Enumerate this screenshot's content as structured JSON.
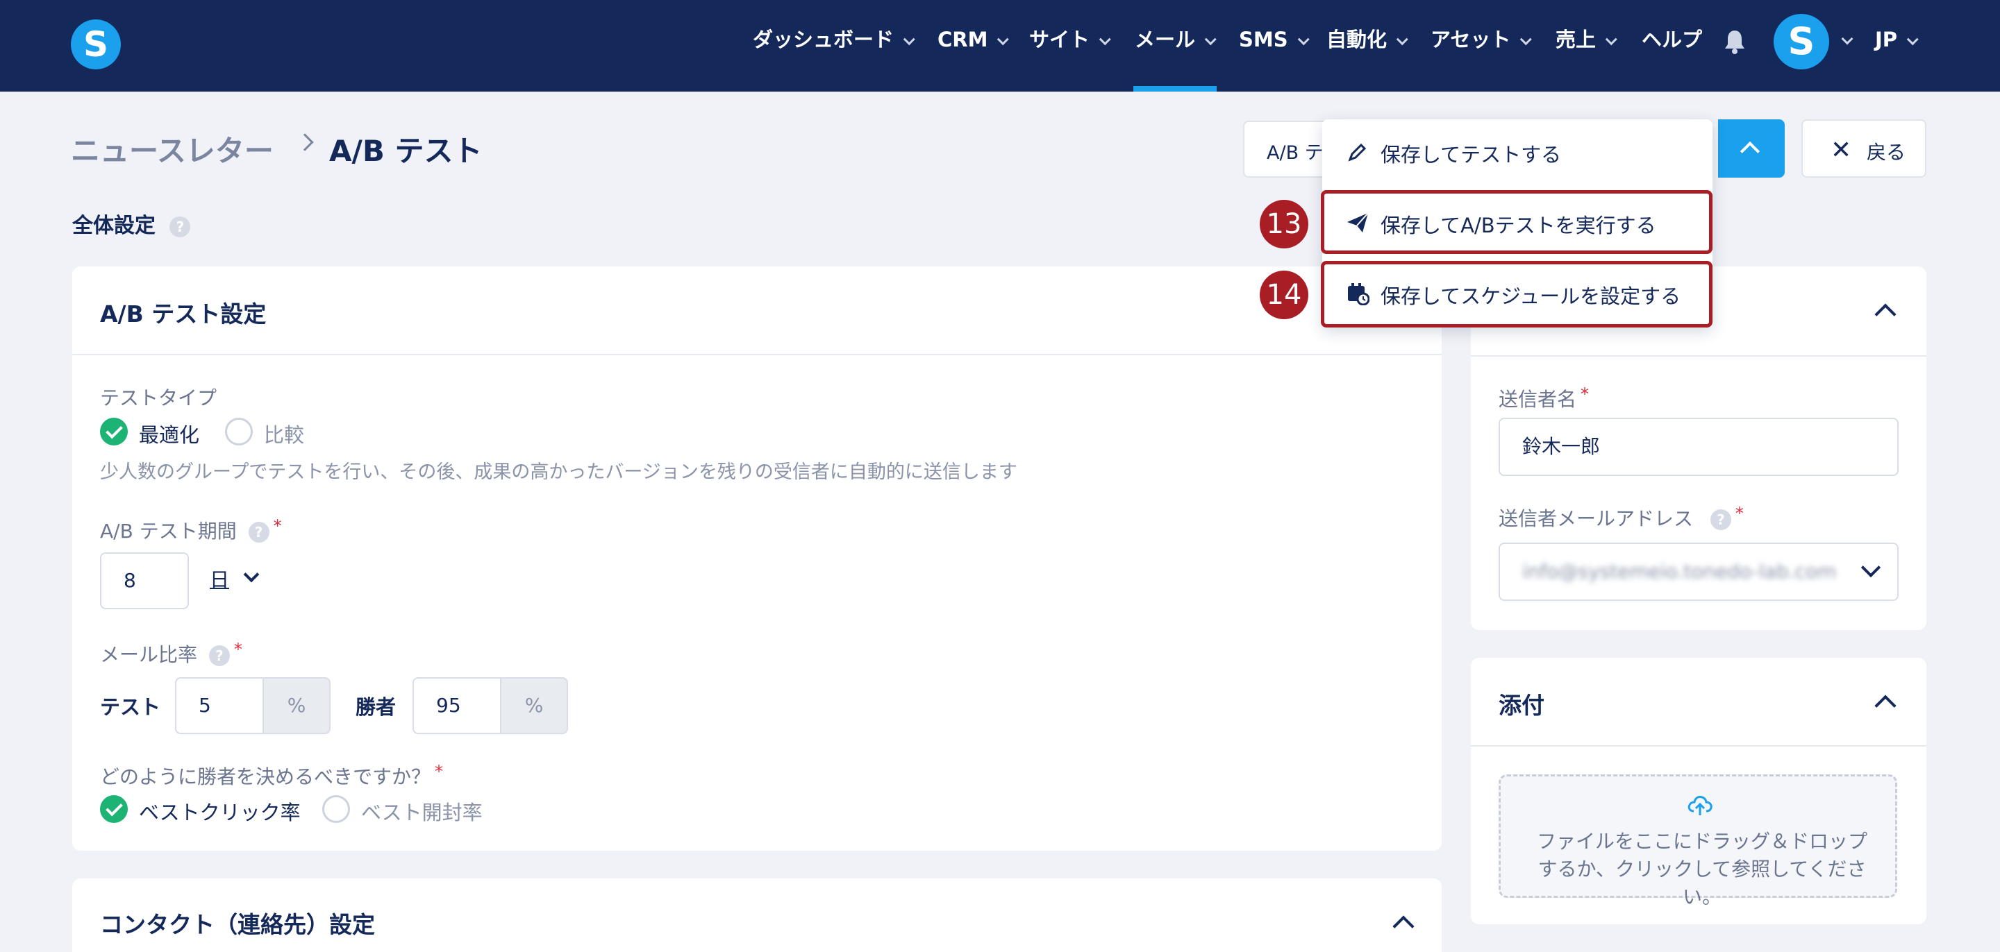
{
  "nav": {
    "logo": "S",
    "items": [
      "ダッシュボード",
      "CRM",
      "サイト",
      "メール",
      "SMS",
      "自動化",
      "アセット",
      "売上",
      "ヘルプ"
    ],
    "active": "メール",
    "avatar": "S",
    "lang": "JP"
  },
  "breadcrumb": {
    "parent": "ニュースレター",
    "current": "A/B テスト"
  },
  "actions": {
    "ab_button_label": "A/B テ",
    "back_label": "戻る",
    "menu": [
      {
        "label": "保存してテストする",
        "icon": "pencil-icon"
      },
      {
        "label": "保存してA/Bテストを実行する",
        "icon": "paper-plane-icon",
        "badge": "13"
      },
      {
        "label": "保存してスケジュールを設定する",
        "icon": "calendar-clock-icon",
        "badge": "14"
      }
    ]
  },
  "general": {
    "title": "全体設定",
    "help": "?",
    "ab_card": {
      "title": "A/B テスト設定",
      "test_type_label": "テストタイプ",
      "opt_optimize": "最適化",
      "opt_compare": "比較",
      "description": "少人数のグループでテストを行い、その後、成果の高かったバージョンを残りの受信者に自動的に送信します",
      "period_label": "A/B テスト期間",
      "period_value": "8",
      "period_unit": "日",
      "ratio_label": "メール比率",
      "test_label": "テスト",
      "test_value": "5",
      "winner_label": "勝者",
      "winner_value": "95",
      "percent": "%",
      "decide_label": "どのように勝者を決めるべきですか？",
      "opt_click": "ベストクリック率",
      "opt_open": "ベスト開封率"
    },
    "contact_card": {
      "title": "コンタクト（連絡先）設定"
    }
  },
  "sender": {
    "name_label": "送信者名",
    "name_value": "鈴木一郎",
    "email_label": "送信者メールアドレス",
    "email_value": "info@systemeio.tonedo-lab.com"
  },
  "attach": {
    "title": "添付",
    "upload_text": "ファイルをここにドラッグ＆ドロップするか、クリックして参照してください。"
  },
  "colors": {
    "nav_bg": "#14285a",
    "accent": "#1aa0ec",
    "highlight": "#a91d24",
    "success": "#1cb374"
  }
}
